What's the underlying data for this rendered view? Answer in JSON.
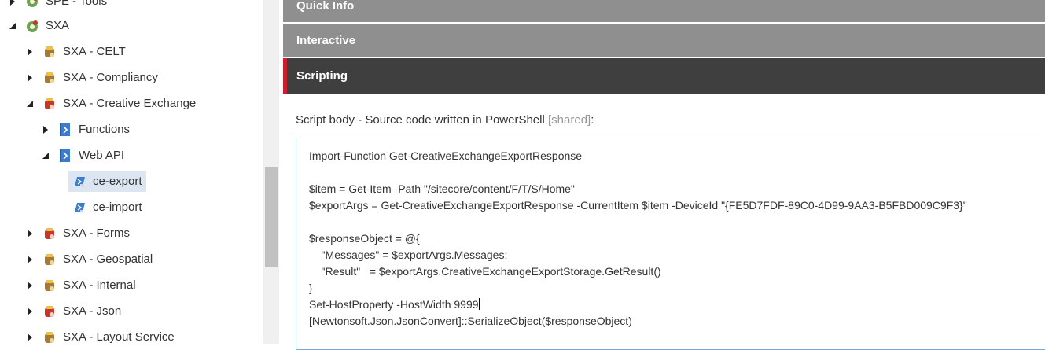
{
  "tree": {
    "items": [
      {
        "label": "SPE - Tools",
        "icon": "spe-gear-icon",
        "toggle": "collapsed"
      },
      {
        "label": "SXA",
        "icon": "spe-gear-icon",
        "toggle": "expanded"
      },
      {
        "label": "SXA - CELT",
        "icon": "script-library-icon",
        "toggle": "collapsed"
      },
      {
        "label": "SXA - Compliancy",
        "icon": "script-library-icon",
        "toggle": "collapsed"
      },
      {
        "label": "SXA - Creative Exchange",
        "icon": "script-library-red-icon",
        "toggle": "expanded"
      },
      {
        "label": "Functions",
        "icon": "powershell-folder-icon",
        "toggle": "collapsed"
      },
      {
        "label": "Web API",
        "icon": "powershell-folder-icon",
        "toggle": "expanded"
      },
      {
        "label": "ce-export",
        "icon": "powershell-script-icon",
        "toggle": "none"
      },
      {
        "label": "ce-import",
        "icon": "powershell-script-icon",
        "toggle": "none"
      },
      {
        "label": "SXA - Forms",
        "icon": "script-library-red-icon",
        "toggle": "collapsed"
      },
      {
        "label": "SXA - Geospatial",
        "icon": "script-library-icon",
        "toggle": "collapsed"
      },
      {
        "label": "SXA - Internal",
        "icon": "script-library-icon",
        "toggle": "collapsed"
      },
      {
        "label": "SXA - Json",
        "icon": "script-library-red-icon",
        "toggle": "collapsed"
      },
      {
        "label": "SXA - Layout Service",
        "icon": "script-library-icon",
        "toggle": "collapsed"
      }
    ]
  },
  "sections": {
    "quick_info": "Quick Info",
    "interactive": "Interactive",
    "scripting": "Scripting"
  },
  "field": {
    "label": "Script body - Source code written in PowerShell",
    "shared": "[shared]",
    "colon": ":"
  },
  "editor": {
    "lines": [
      "Import-Function Get-CreativeExchangeExportResponse",
      "",
      "$item = Get-Item -Path \"/sitecore/content/F/T/S/Home\"",
      "$exportArgs = Get-CreativeExchangeExportResponse -CurrentItem $item -DeviceId \"{FE5D7FDF-89C0-4D99-9AA3-B5FBD009C9F3}\"",
      "",
      "$responseObject = @{",
      "    \"Messages\" = $exportArgs.Messages;",
      "    \"Result\"   = $exportArgs.CreativeExchangeExportStorage.GetResult()",
      "}",
      "Set-HostProperty -HostWidth 9999",
      "[Newtonsoft.Json.JsonConvert]::SerializeObject($responseObject)"
    ]
  },
  "colors": {
    "section_gray": "#8f8f8f",
    "section_active": "#3f3f3f",
    "accent_red": "#c8202a",
    "selection": "#dce6f2",
    "editor_border": "#7aa8dc"
  }
}
